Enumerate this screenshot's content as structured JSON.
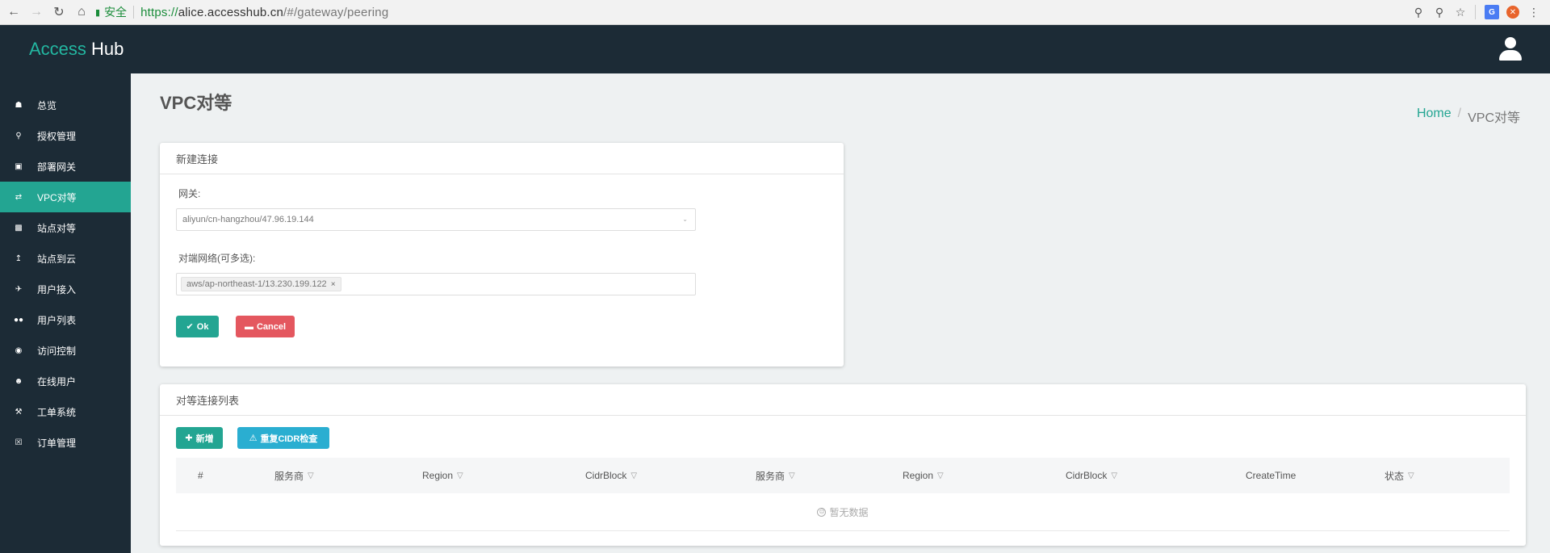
{
  "browser": {
    "secure_label": "安全",
    "url_scheme": "https://",
    "url_host": "alice.accesshub.cn",
    "url_path": "/#/gateway/peering",
    "translate_icon_text": "G"
  },
  "header": {
    "logo_accent": "Access",
    "logo_rest": " Hub"
  },
  "sidebar": {
    "items": [
      {
        "label": "总览",
        "icon": "home-icon"
      },
      {
        "label": "授权管理",
        "icon": "key-icon"
      },
      {
        "label": "部署网关",
        "icon": "cube-icon"
      },
      {
        "label": "VPC对等",
        "icon": "shuffle-icon",
        "active": true
      },
      {
        "label": "站点对等",
        "icon": "sitemap-icon"
      },
      {
        "label": "站点到云",
        "icon": "upload-icon"
      },
      {
        "label": "用户接入",
        "icon": "plane-icon"
      },
      {
        "label": "用户列表",
        "icon": "users-icon"
      },
      {
        "label": "访问控制",
        "icon": "circle-icon"
      },
      {
        "label": "在线用户",
        "icon": "user-icon"
      },
      {
        "label": "工单系统",
        "icon": "wrench-icon"
      },
      {
        "label": "订单管理",
        "icon": "cart-icon"
      }
    ]
  },
  "page": {
    "title": "VPC对等",
    "breadcrumb_home": "Home",
    "breadcrumb_sep": "/",
    "breadcrumb_current": "VPC对等"
  },
  "new_connection": {
    "title": "新建连接",
    "gateway_label": "网关:",
    "gateway_value": "aliyun/cn-hangzhou/47.96.19.144",
    "peer_label": "对端网络(可多选):",
    "peer_tags": [
      "aws/ap-northeast-1/13.230.199.122"
    ],
    "ok_label": "Ok",
    "cancel_label": "Cancel"
  },
  "peer_list": {
    "title": "对等连接列表",
    "add_label": "新增",
    "cidr_label": "重复CIDR检查",
    "columns": [
      "#",
      "服务商",
      "Region",
      "CidrBlock",
      "服务商",
      "Region",
      "CidrBlock",
      "CreateTime",
      "状态"
    ],
    "empty_text": "暂无数据"
  },
  "colors": {
    "accent": "#23a592",
    "danger": "#e4575f",
    "info": "#2aaed1",
    "dark": "#1c2b36"
  }
}
